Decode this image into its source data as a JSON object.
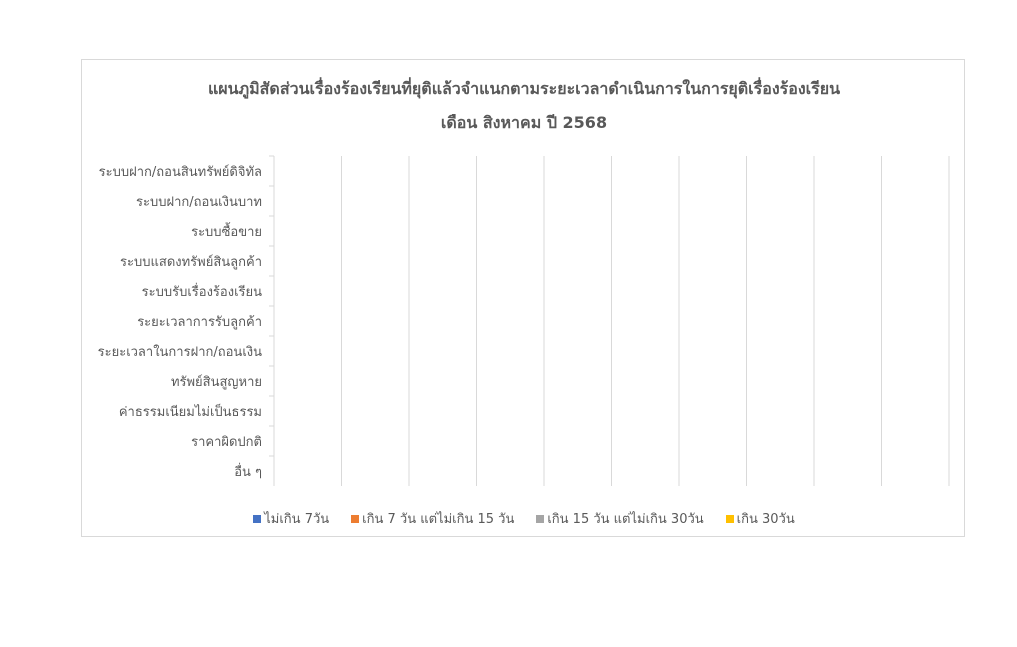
{
  "chart_data": {
    "type": "bar",
    "orientation": "horizontal",
    "stacked": true,
    "title": "แผนภูมิสัดส่วนเรื่องร้องเรียนที่ยุติแล้วจำแนกตามระยะเวลาดำเนินการในการยุติเรื่องร้องเรียน",
    "subtitle": "เดือน สิงหาคม ปี 2568",
    "xlabel": "",
    "ylabel": "",
    "categories": [
      "ระบบฝาก/ถอนสินทรัพย์ดิจิทัล",
      "ระบบฝาก/ถอนเงินบาท",
      "ระบบซื้อขาย",
      "ระบบแสดงทรัพย์สินลูกค้า",
      "ระบบรับเรื่องร้องเรียน",
      "ระยะเวลาการรับลูกค้า",
      "ระยะเวลาในการฝาก/ถอนเงิน",
      "ทรัพย์สินสูญหาย",
      "ค่าธรรมเนียมไม่เป็นธรรม",
      "ราคาผิดปกติ",
      "อื่น ๆ"
    ],
    "series": [
      {
        "name": "ไม่เกิน 7วัน",
        "color": "#4472c4",
        "values": [
          0,
          0,
          0,
          0,
          0,
          0,
          0,
          0,
          0,
          0,
          0
        ]
      },
      {
        "name": "เกิน 7 วัน แต่ไม่เกิน 15 วัน",
        "color": "#ed7d31",
        "values": [
          0,
          0,
          0,
          0,
          0,
          0,
          0,
          0,
          0,
          0,
          0
        ]
      },
      {
        "name": "เกิน 15 วัน แต่ไม่เกิน 30วัน",
        "color": "#a5a5a5",
        "values": [
          0,
          0,
          0,
          0,
          0,
          0,
          0,
          0,
          0,
          0,
          0
        ]
      },
      {
        "name": "เกิน 30วัน",
        "color": "#ffc000",
        "values": [
          0,
          0,
          0,
          0,
          0,
          0,
          0,
          0,
          0,
          0,
          0
        ]
      }
    ],
    "xlim": [
      0,
      10
    ],
    "grid": true,
    "tick_labels_visible": false,
    "legend_position": "bottom"
  }
}
